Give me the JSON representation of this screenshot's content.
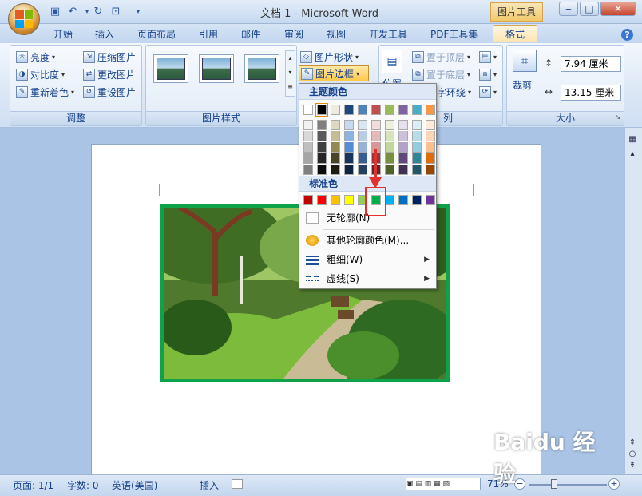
{
  "window": {
    "title": "文档 1 - Microsoft Word",
    "context_tab": "图片工具"
  },
  "tabs": [
    "开始",
    "插入",
    "页面布局",
    "引用",
    "邮件",
    "审阅",
    "视图",
    "开发工具",
    "PDF工具集",
    "格式"
  ],
  "active_tab": "格式",
  "ribbon": {
    "adjust": {
      "label": "调整",
      "items": {
        "brightness": "亮度",
        "contrast": "对比度",
        "recolor": "重新着色",
        "compress": "压缩图片",
        "change": "更改图片",
        "reset": "重设图片"
      }
    },
    "picture_styles": {
      "label": "图片样式",
      "shape": "图片形状",
      "border": "图片边框"
    },
    "arrange": {
      "label": "列",
      "front": "置于顶层",
      "back": "置于底层",
      "wrap": "字环绕",
      "position": "位置"
    },
    "size": {
      "label": "大小",
      "crop": "裁剪",
      "height": "7.94 厘米",
      "width": "13.15 厘米"
    }
  },
  "menu": {
    "theme_header": "主题颜色",
    "standard_header": "标准色",
    "theme_top_row": [
      "#ffffff",
      "#000000",
      "#eeece1",
      "#1f497d",
      "#4f81bd",
      "#c0504d",
      "#9bbb59",
      "#8064a2",
      "#4bacc6",
      "#f79646"
    ],
    "theme_shades": [
      [
        "#f2f2f2",
        "#d8d8d8",
        "#bfbfbf",
        "#a5a5a5",
        "#7f7f7f"
      ],
      [
        "#7f7f7f",
        "#595959",
        "#3f3f3f",
        "#262626",
        "#0c0c0c"
      ],
      [
        "#ddd9c3",
        "#c4bd97",
        "#938953",
        "#494429",
        "#1d1b10"
      ],
      [
        "#c6d9f0",
        "#8db3e2",
        "#548dd4",
        "#17365d",
        "#0f243e"
      ],
      [
        "#dbe5f1",
        "#b8cce4",
        "#95b3d7",
        "#366092",
        "#244061"
      ],
      [
        "#f2dcdb",
        "#e5b9b7",
        "#d99694",
        "#953734",
        "#632423"
      ],
      [
        "#ebf1dd",
        "#d7e3bc",
        "#c3d69b",
        "#76923c",
        "#4f6128"
      ],
      [
        "#e5e0ec",
        "#ccc1d9",
        "#b2a2c7",
        "#5f497a",
        "#3f3151"
      ],
      [
        "#dbeef3",
        "#b7dde8",
        "#92cddc",
        "#31859b",
        "#205867"
      ],
      [
        "#fdeada",
        "#fbd5b5",
        "#fac08f",
        "#e36c09",
        "#974806"
      ]
    ],
    "standard_colors": [
      "#c00000",
      "#ff0000",
      "#ffc000",
      "#ffff00",
      "#92d050",
      "#00b050",
      "#00b0f0",
      "#0070c0",
      "#002060",
      "#7030a0"
    ],
    "selected_standard_index": 5,
    "items": [
      {
        "label": "无轮廓(N)"
      },
      {
        "label": "其他轮廓颜色(M)..."
      },
      {
        "label": "粗细(W)"
      },
      {
        "label": "虚线(S)"
      }
    ],
    "highlight_color": "#e03030"
  },
  "picture": {
    "border_color": "#10a24a"
  },
  "status": {
    "page": "页面: 1/1",
    "words": "字数: 0",
    "lang": "英语(美国)",
    "mode": "插入",
    "zoom": "71%"
  },
  "watermark": "Baidu 经验"
}
